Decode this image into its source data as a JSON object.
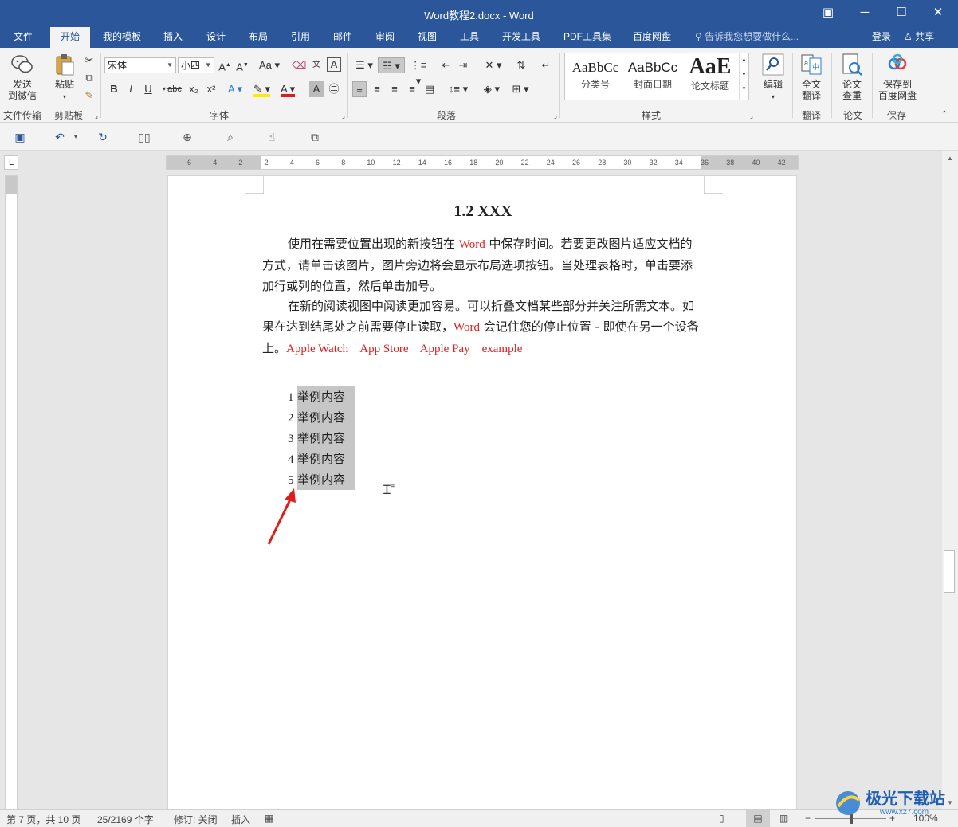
{
  "window": {
    "title": "Word教程2.docx - Word",
    "controls": [
      "▣",
      "─",
      "☐",
      "✕"
    ]
  },
  "tabs": [
    "文件",
    "开始",
    "我的模板",
    "插入",
    "设计",
    "布局",
    "引用",
    "邮件",
    "审阅",
    "视图",
    "工具",
    "开发工具",
    "PDF工具集",
    "百度网盘"
  ],
  "tell_me": "告诉我您想要做什么...",
  "account": {
    "login": "登录",
    "share": "共享"
  },
  "ribbon": {
    "send_wechat": [
      "发送",
      "到微信"
    ],
    "file_transfer": "文件传输",
    "paste": "粘贴",
    "clipboard": "剪贴板",
    "font_name": "宋体",
    "font_size": "小四",
    "font_group": "字体",
    "paragraph_group": "段落",
    "styles_group": "样式",
    "styles": [
      {
        "sample": "AaBbCc",
        "name": "分类号"
      },
      {
        "sample": "AaBbCc",
        "name": "封面日期"
      },
      {
        "sample": "AaE",
        "name": "论文标题"
      }
    ],
    "edit": "编辑",
    "translate_full": [
      "全文",
      "翻译"
    ],
    "translate_group": "翻译",
    "paper_check": [
      "论文",
      "查重"
    ],
    "paper_group": "论文",
    "save_baidu": [
      "保存到",
      "百度网盘"
    ],
    "save_group": "保存",
    "font_buttons": [
      "B",
      "I",
      "U",
      "abc",
      "x₂",
      "x²"
    ],
    "case_btn": "Aa"
  },
  "ruler": {
    "labels": [
      "6",
      "4",
      "2",
      "2",
      "4",
      "6",
      "8",
      "10",
      "12",
      "14",
      "16",
      "18",
      "20",
      "22",
      "24",
      "26",
      "28",
      "30",
      "32",
      "34",
      "36",
      "38",
      "40",
      "42"
    ],
    "tab_selector": "L"
  },
  "document": {
    "heading": "1.2 XXX",
    "p1_a": "使用在需要位置出现的新按钮在 ",
    "p1_word": "Word",
    "p1_b": " 中保存时间。若要更改图片适应文档的方式，请单击该图片，图片旁边将会显示布局选项按钮。当处理表格时，单击要添加行或列的位置，然后单击加号。",
    "p2_a": "在新的阅读视图中阅读更加容易。可以折叠文档某些部分并关注所需文本。如果在达到结尾处之前需要停止读取，",
    "p2_word": "Word",
    "p2_b": " 会记住您的停止位置 - 即使在另一个设备上。",
    "p2_red": "Apple Watch    App Store    Apple Pay    example",
    "list": [
      {
        "num": "1",
        "text": "举例内容"
      },
      {
        "num": "2",
        "text": "举例内容"
      },
      {
        "num": "3",
        "text": "举例内容"
      },
      {
        "num": "4",
        "text": "举例内容"
      },
      {
        "num": "5",
        "text": "举例内容"
      }
    ]
  },
  "status": {
    "page": "第 7 页，共 10 页",
    "words": "25/2169 个字",
    "track": "修订: 关闭",
    "insert": "插入",
    "zoom": "100%"
  },
  "watermark": {
    "text": "极光下载站",
    "url": "www.xz7.com"
  },
  "colors": {
    "brand": "#2b579a",
    "red_text": "#e01b1b",
    "highlight": "#c6c6c6"
  }
}
